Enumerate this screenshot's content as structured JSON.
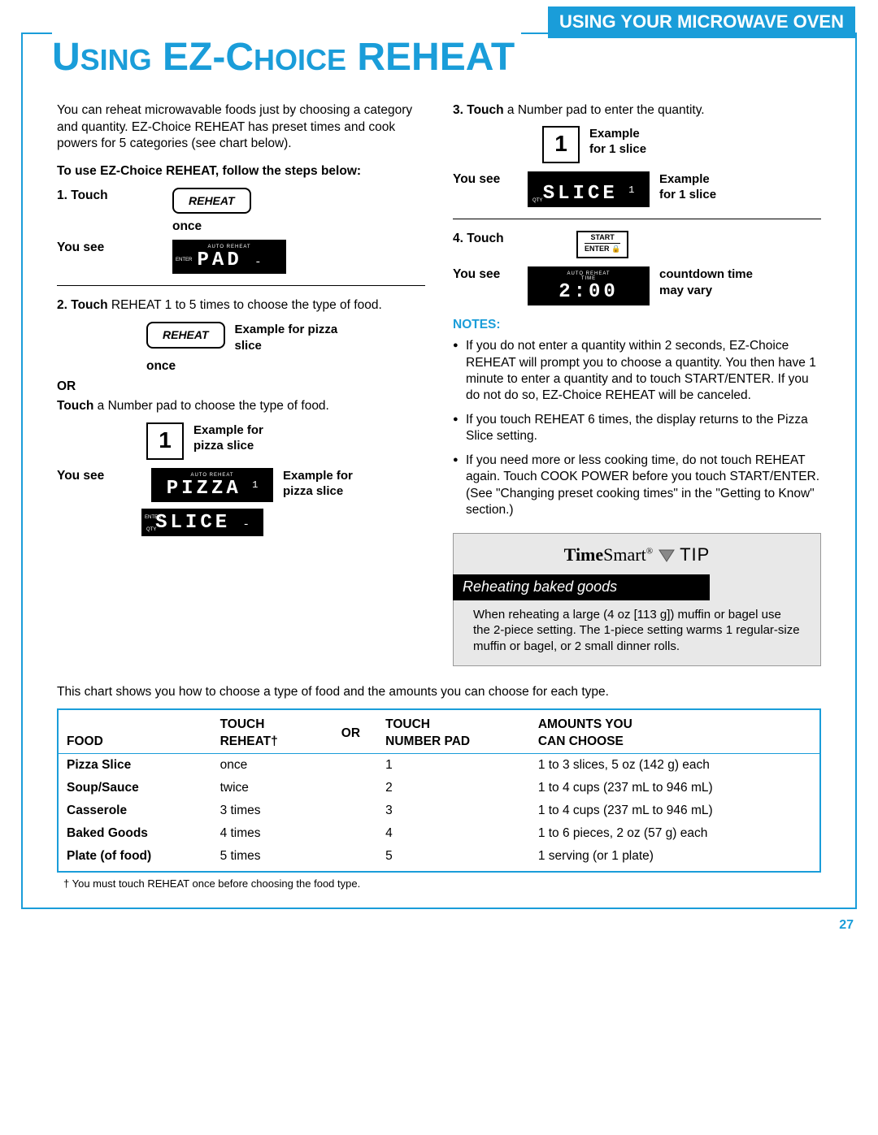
{
  "header_bar": "USING YOUR MICROWAVE OVEN",
  "title_parts": {
    "u1": "U",
    "sing": "SING",
    "ez": " EZ-C",
    "hoice": "HOICE",
    "reheat": " REHEAT"
  },
  "intro": "You can reheat microwavable foods just by choosing a category and quantity. EZ-Choice REHEAT has preset times and cook powers for 5 categories (see chart below).",
  "steps_heading": "To use EZ-Choice REHEAT, follow the steps below:",
  "s1": {
    "n": "1.",
    "label": "Touch",
    "btn": "REHEAT",
    "once": "once",
    "yousee": "You see",
    "disp_top": "AUTO   REHEAT",
    "disp_left": "ENTER",
    "disp": "PAD",
    "dash": "-"
  },
  "s2": {
    "n": "2.",
    "label": "Touch",
    "rest": " REHEAT 1 to 5 times to choose the type of food.",
    "btn": "REHEAT",
    "once": "once",
    "ex1": "Example for pizza slice",
    "or": "OR",
    "alt": "Touch",
    "alt_rest": " a Number pad to choose the type of food.",
    "pad": "1",
    "ex2": "Example for pizza slice",
    "yousee": "You see",
    "disp1_top": "AUTO   REHEAT",
    "disp1": "PIZZA",
    "disp1_sub": "1",
    "disp2_left": "ENTER",
    "disp2": "SLICE",
    "disp2_dash": "-",
    "disp2_qty": "QTY",
    "ex3": "Example for pizza slice"
  },
  "s3": {
    "n": "3.",
    "label": "Touch",
    "rest": " a Number pad to enter the quantity.",
    "pad": "1",
    "ex1": "Example\nfor 1 slice",
    "yousee": "You see",
    "disp": "SLICE",
    "disp_sub": "1",
    "disp_qty": "QTY",
    "ex2": "Example\nfor 1 slice"
  },
  "s4": {
    "n": "4.",
    "label": "Touch",
    "btn_top": "START",
    "btn_mid": "ENTER",
    "yousee": "You see",
    "disp_top": "AUTO   REHEAT\nTIME",
    "disp": "2:00",
    "note": "countdown time may vary"
  },
  "notes_head": "NOTES:",
  "notes": [
    "If you do not enter a quantity within 2 seconds, EZ-Choice REHEAT will prompt you to choose a quantity. You then have 1 minute to enter a quantity and to touch START/ENTER. If you do not do so, EZ-Choice REHEAT will be canceled.",
    "If you touch REHEAT 6 times, the display returns to the Pizza Slice setting.",
    "If you need more or less cooking time, do not touch REHEAT again. Touch COOK POWER before you touch START/ENTER. (See \"Changing preset cooking times\" in the \"Getting to Know\" section.)"
  ],
  "tip": {
    "brand_bold": "Time",
    "brand_light": "Smart",
    "reg": "®",
    "word": " TIP",
    "subtitle": "Reheating baked goods",
    "body": "When reheating a large (4 oz [113 g]) muffin or bagel use the 2-piece setting. The 1-piece setting warms 1 regular-size muffin or bagel, or 2 small dinner rolls."
  },
  "chart_intro": "This chart shows you how to choose a type of food and the amounts you can choose for each type.",
  "chart_headers": {
    "food": "FOOD",
    "reheat": "TOUCH\nREHEAT†",
    "or": "OR",
    "pad": "TOUCH\nNUMBER PAD",
    "amounts": "AMOUNTS YOU\nCAN CHOOSE"
  },
  "chart_rows": [
    {
      "food": "Pizza Slice",
      "reheat": "once",
      "pad": "1",
      "amounts": "1 to 3 slices, 5 oz (142 g) each"
    },
    {
      "food": "Soup/Sauce",
      "reheat": "twice",
      "pad": "2",
      "amounts": "1 to 4 cups (237 mL to 946 mL)"
    },
    {
      "food": "Casserole",
      "reheat": "3 times",
      "pad": "3",
      "amounts": "1 to 4 cups (237 mL to 946 mL)"
    },
    {
      "food": "Baked Goods",
      "reheat": "4 times",
      "pad": "4",
      "amounts": "1 to 6 pieces, 2 oz (57 g) each"
    },
    {
      "food": "Plate (of food)",
      "reheat": "5 times",
      "pad": "5",
      "amounts": "1 serving (or 1 plate)"
    }
  ],
  "footnote": "† You must touch REHEAT once before choosing the food type.",
  "pagenum": "27"
}
